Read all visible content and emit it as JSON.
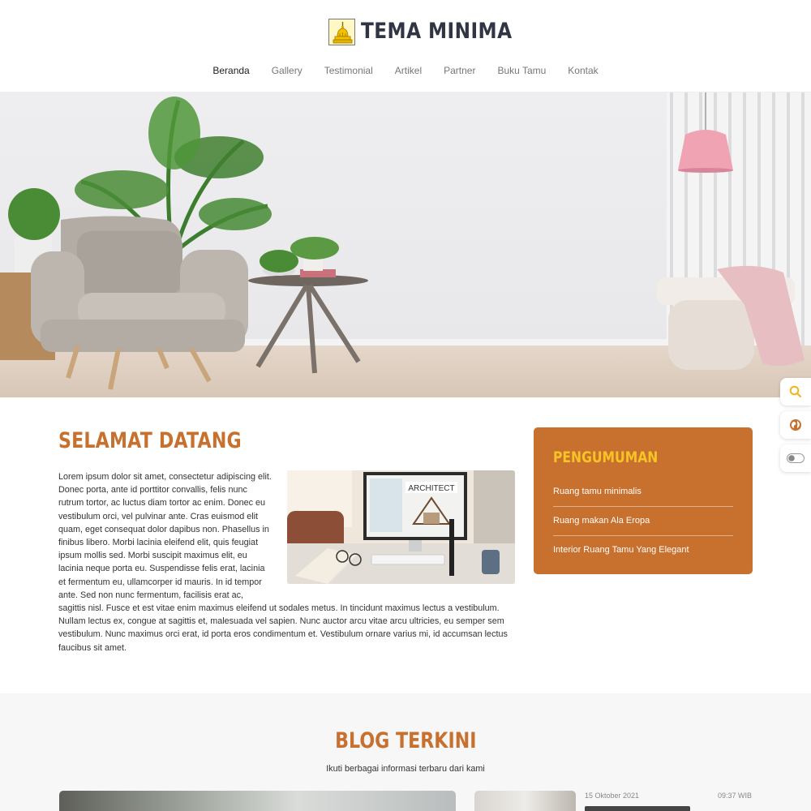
{
  "brand": {
    "name": "TEMA MINIMA"
  },
  "nav": {
    "items": [
      {
        "label": "Beranda",
        "active": true
      },
      {
        "label": "Gallery",
        "active": false
      },
      {
        "label": "Testimonial",
        "active": false
      },
      {
        "label": "Artikel",
        "active": false
      },
      {
        "label": "Partner",
        "active": false
      },
      {
        "label": "Buku Tamu",
        "active": false
      },
      {
        "label": "Kontak",
        "active": false
      }
    ]
  },
  "welcome": {
    "title": "SELAMAT DATANG",
    "body": "Lorem ipsum dolor sit amet, consectetur adipiscing elit. Donec porta, ante id porttitor convallis, felis nunc rutrum tortor, ac luctus diam tortor ac enim. Donec eu vestibulum orci, vel pulvinar ante. Cras euismod elit quam, eget consequat dolor dapibus non. Phasellus in finibus libero. Morbi lacinia eleifend elit, quis feugiat ipsum mollis sed. Morbi suscipit maximus elit, eu lacinia neque porta eu. Suspendisse felis erat, lacinia et fermentum eu, ullamcorper id mauris. In id tempor ante. Sed non nunc fermentum, facilisis erat ac, sagittis nisl. Fusce et est vitae enim maximus eleifend ut sodales metus. In tincidunt maximus lectus a vestibulum. Nullam lectus ex, congue at sagittis et, malesuada vel sapien. Nunc auctor arcu vitae arcu ultricies, eu semper sem vestibulum. Nunc maximus orci erat, id porta eros condimentum et. Vestibulum ornare varius mi, id accumsan lectus faucibus sit amet.",
    "image_sign": "ARCHITECT"
  },
  "announcement": {
    "title": "PENGUMUMAN",
    "items": [
      "Ruang tamu minimalis",
      "Ruang makan Ala Eropa",
      "Interior Ruang Tamu Yang Elegant"
    ]
  },
  "side_tools": {
    "icons": [
      "search-icon",
      "globe-icon",
      "toggle-icon"
    ]
  },
  "blog": {
    "title": "BLOG TERKINI",
    "subtitle": "Ikuti berbagai informasi terbaru dari kami",
    "post": {
      "date": "15 Oktober 2021",
      "time": "09:37 WIB"
    }
  },
  "colors": {
    "accent": "#c8702e",
    "accent_title": "#f7c325",
    "text": "#333333"
  }
}
